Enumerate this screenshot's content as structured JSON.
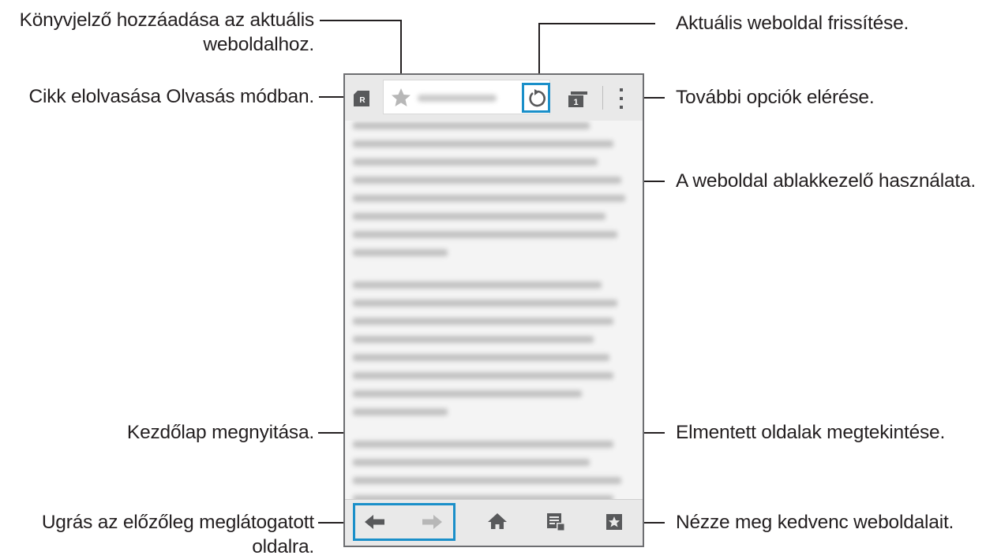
{
  "callouts": {
    "bookmark_add_line1": "Könyvjelző hozzáadása az aktuális",
    "bookmark_add_line2": "weboldalhoz.",
    "reader_mode": "Cikk elolvasása Olvasás módban.",
    "home_page": "Kezdőlap megnyitása.",
    "back_line1": "Ugrás az előzőleg meglátogatott",
    "back_line2": "oldalra.",
    "refresh": "Aktuális weboldal frissítése.",
    "more_options": "További opciók elérése.",
    "window_manager": "A weboldal ablakkezelő használata.",
    "saved_pages": "Elmentett oldalak megtekintése.",
    "favorites": "Nézze meg kedvenc weboldalait."
  },
  "browser": {
    "reader_icon_letter": "R",
    "tab_count": "1"
  },
  "colors": {
    "highlight": "#1a8fc9",
    "icon_gray": "#58595b",
    "line": "#231f20"
  },
  "icons": [
    "reader-mode-icon",
    "star-icon",
    "refresh-icon",
    "tabs-icon",
    "more-options-icon",
    "back-arrow-icon",
    "forward-arrow-icon",
    "home-icon",
    "saved-pages-icon",
    "bookmarks-icon"
  ]
}
